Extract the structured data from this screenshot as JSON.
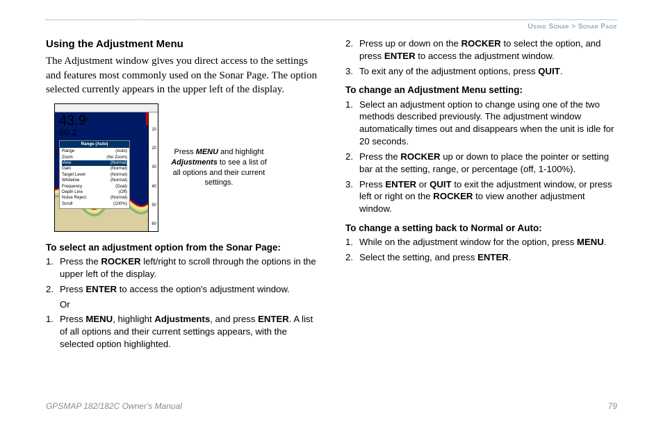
{
  "breadcrumb": {
    "section": "Using Sonar",
    "sep": " > ",
    "page": "Sonar Page"
  },
  "left": {
    "heading": "Using the Adjustment Menu",
    "intro": "The Adjustment window gives you direct access to the settings and features most commonly used on the Sonar Page. The option selected currently appears in the upper left of the display.",
    "figure": {
      "depth_big": "43.9",
      "depth_unit": "ft",
      "depth_small": "60.2",
      "menu_title": "Range (Auto)",
      "menu_rows": [
        {
          "l": "Range",
          "r": "(Auto)"
        },
        {
          "l": "Zoom",
          "r": "(No Zoom)"
        },
        {
          "l": "View",
          "r": "(Normal)"
        },
        {
          "l": "Gain",
          "r": "(Normal)"
        },
        {
          "l": "Target Level",
          "r": "(Normal)"
        },
        {
          "l": "Whiteline",
          "r": "(Normal)"
        },
        {
          "l": "Frequency",
          "r": "(Dual)"
        },
        {
          "l": "Depth Line",
          "r": "(Off)"
        },
        {
          "l": "Noise Reject",
          "r": "(Normal)"
        },
        {
          "l": "Scroll",
          "r": "(100%)"
        }
      ],
      "scale": {
        "t1": "10",
        "t2": "20",
        "t3": "30",
        "t4": "40",
        "t5": "50",
        "t6": "60"
      }
    },
    "caption_pre": "Press ",
    "caption_menu": "MENU",
    "caption_mid1": " and highlight ",
    "caption_adj": "Adjustments",
    "caption_mid2": " to see a list of all options and their current settings.",
    "h3a": "To select an adjustment option from the Sonar Page:",
    "l1_pre": "Press the ",
    "l1_b": "ROCKER",
    "l1_post": " left/right to scroll through the options in the upper left of the display.",
    "l2_pre": "Press ",
    "l2_b": "ENTER",
    "l2_post": " to access the option's adjustment window.",
    "or": "Or",
    "lb1_pre": "Press ",
    "lb1_b1": "MENU",
    "lb1_mid": ", highlight ",
    "lb1_b2": "Adjustments",
    "lb1_mid2": ", and press ",
    "lb1_b3": "ENTER",
    "lb1_post": ". A list of all options and their current settings appears, with the selected option highlighted."
  },
  "right": {
    "r2_pre": "Press up or down on the ",
    "r2_b": "ROCKER",
    "r2_mid": " to select the option, and press ",
    "r2_b2": "ENTER",
    "r2_post": " to access the adjustment window.",
    "r3_pre": "To exit any of the adjustment options, press ",
    "r3_b": "QUIT",
    "r3_post": ".",
    "h3b": "To change an Adjustment Menu setting:",
    "s1": "Select an adjustment option to change using one of the two methods described previously. The adjustment window automatically times out and disappears when the unit is idle for 20 seconds.",
    "s2_pre": "Press the ",
    "s2_b": "ROCKER",
    "s2_post": " up or down to place the pointer or setting bar at the setting, range, or percentage (off, 1-100%).",
    "s3_pre": "Press ",
    "s3_b1": "ENTER",
    "s3_mid1": " or ",
    "s3_b2": "QUIT",
    "s3_mid2": " to exit the adjustment window, or press left or right on the ",
    "s3_b3": "ROCKER",
    "s3_post": " to view another adjustment window.",
    "h3c": "To change a setting back to Normal or Auto:",
    "t1_pre": "While on the adjustment window for the option, press ",
    "t1_b": "MENU",
    "t1_post": ".",
    "t2_pre": "Select the setting, and press ",
    "t2_b": "ENTER",
    "t2_post": "."
  },
  "footer": {
    "left": "GPSMAP 182/182C Owner's Manual",
    "right": "79"
  }
}
